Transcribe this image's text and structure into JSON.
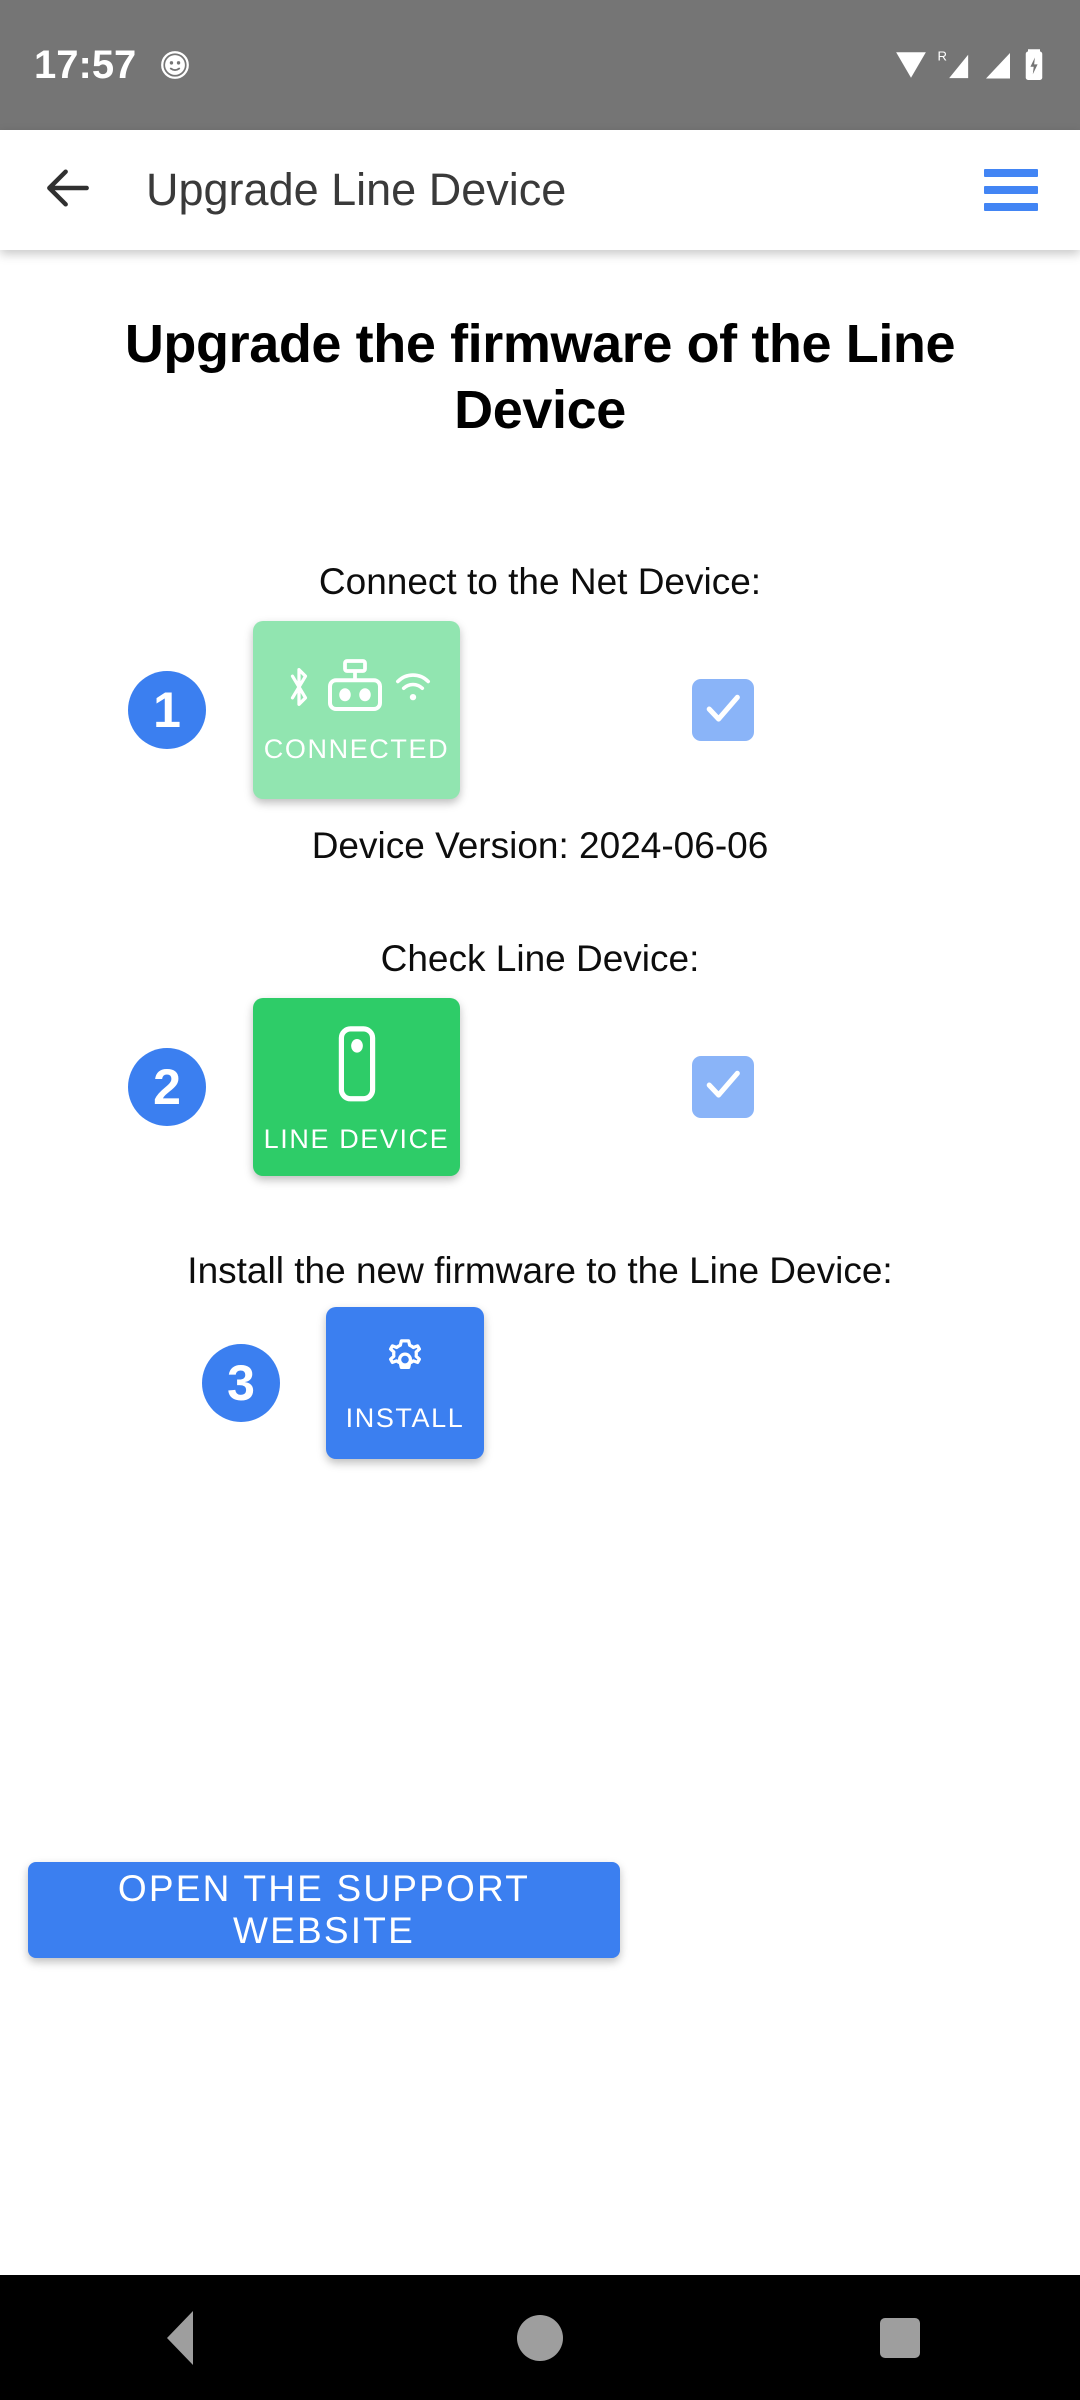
{
  "status_bar": {
    "time": "17:57",
    "left_icons": [
      "alarm-face-icon"
    ],
    "right_icons": [
      "wifi-icon",
      "roaming-signal-icon",
      "signal-icon",
      "battery-charging-icon"
    ],
    "roaming_label": "R",
    "background": "#757575"
  },
  "app_bar": {
    "back_icon": "arrow-back-icon",
    "title": "Upgrade Line Device",
    "menu_icon": "hamburger-menu-icon",
    "menu_color": "#4285f4"
  },
  "main": {
    "heading": "Upgrade the firmware of the Line Device",
    "steps": [
      {
        "number": "1",
        "caption": "Connect to the Net Device:",
        "tile_label": "CONNECTED",
        "tile_color": "#91e5b0",
        "tile_icons": [
          "bluetooth-icon",
          "net-device-icon",
          "wifi-icon"
        ],
        "checked": true,
        "check_color": "#8ab4f8"
      },
      {
        "number": "2",
        "caption": "Check Line Device:",
        "tile_label": "LINE DEVICE",
        "tile_color": "#2ecc68",
        "tile_icons": [
          "line-device-icon"
        ],
        "checked": true,
        "check_color": "#8ab4f8"
      },
      {
        "number": "3",
        "caption": "Install the new firmware to the Line Device:",
        "tile_label": "INSTALL",
        "tile_color": "#3b7ff0",
        "tile_icons": [
          "gear-icon"
        ],
        "checked": false
      }
    ],
    "device_version": "Device Version: 2024-06-06",
    "support_button": "OPEN THE SUPPORT WEBSITE",
    "accent_color": "#3b7ff0"
  },
  "nav_bar": {
    "back": "nav-back-icon",
    "home": "nav-home-icon",
    "recents": "nav-recents-icon",
    "background": "#000000"
  }
}
